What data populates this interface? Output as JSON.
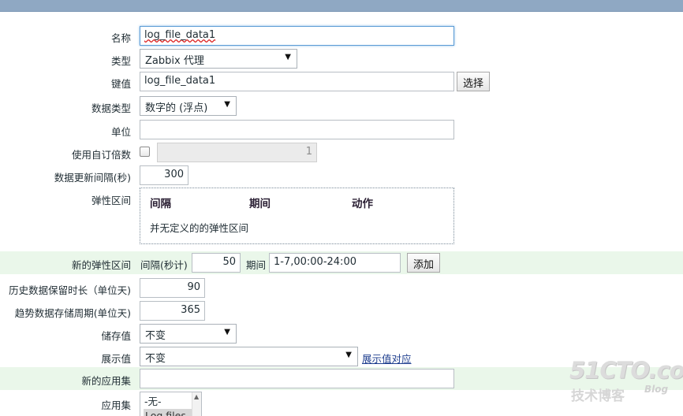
{
  "form": {
    "name": {
      "label": "名称",
      "value": "log_file_data1"
    },
    "type": {
      "label": "类型",
      "value": "Zabbix 代理"
    },
    "key": {
      "label": "键值",
      "value": "log_file_data1",
      "select_button": "选择"
    },
    "data_type": {
      "label": "数据类型",
      "value": "数字的 (浮点)"
    },
    "units": {
      "label": "单位",
      "value": ""
    },
    "multiplier": {
      "label": "使用自订倍数",
      "checked": false,
      "value": "1"
    },
    "update_interval": {
      "label": "数据更新间隔(秒)",
      "value": "300"
    },
    "flexible": {
      "label": "弹性区间",
      "headers": [
        "间隔",
        "期间",
        "动作"
      ],
      "empty_text": "并无定义的的弹性区间"
    },
    "new_flexible": {
      "label": "新的弹性区间",
      "interval_label": "间隔(秒计)",
      "interval_value": "50",
      "period_label": "期间",
      "period_value": "1-7,00:00-24:00",
      "add_button": "添加"
    },
    "history": {
      "label": "历史数据保留时长（单位天)",
      "value": "90"
    },
    "trends": {
      "label": "趋势数据存储周期(单位天)",
      "value": "365"
    },
    "store_value": {
      "label": "储存值",
      "value": "不变"
    },
    "show_value": {
      "label": "展示值",
      "value": "不变",
      "link": "展示值对应"
    },
    "new_application": {
      "label": "新的应用集",
      "value": ""
    },
    "applications": {
      "label": "应用集",
      "options": [
        "-无-",
        "Log files"
      ]
    }
  },
  "watermark": {
    "brand": "51CTO.com",
    "sub": "技术博客",
    "blog": "Blog"
  }
}
